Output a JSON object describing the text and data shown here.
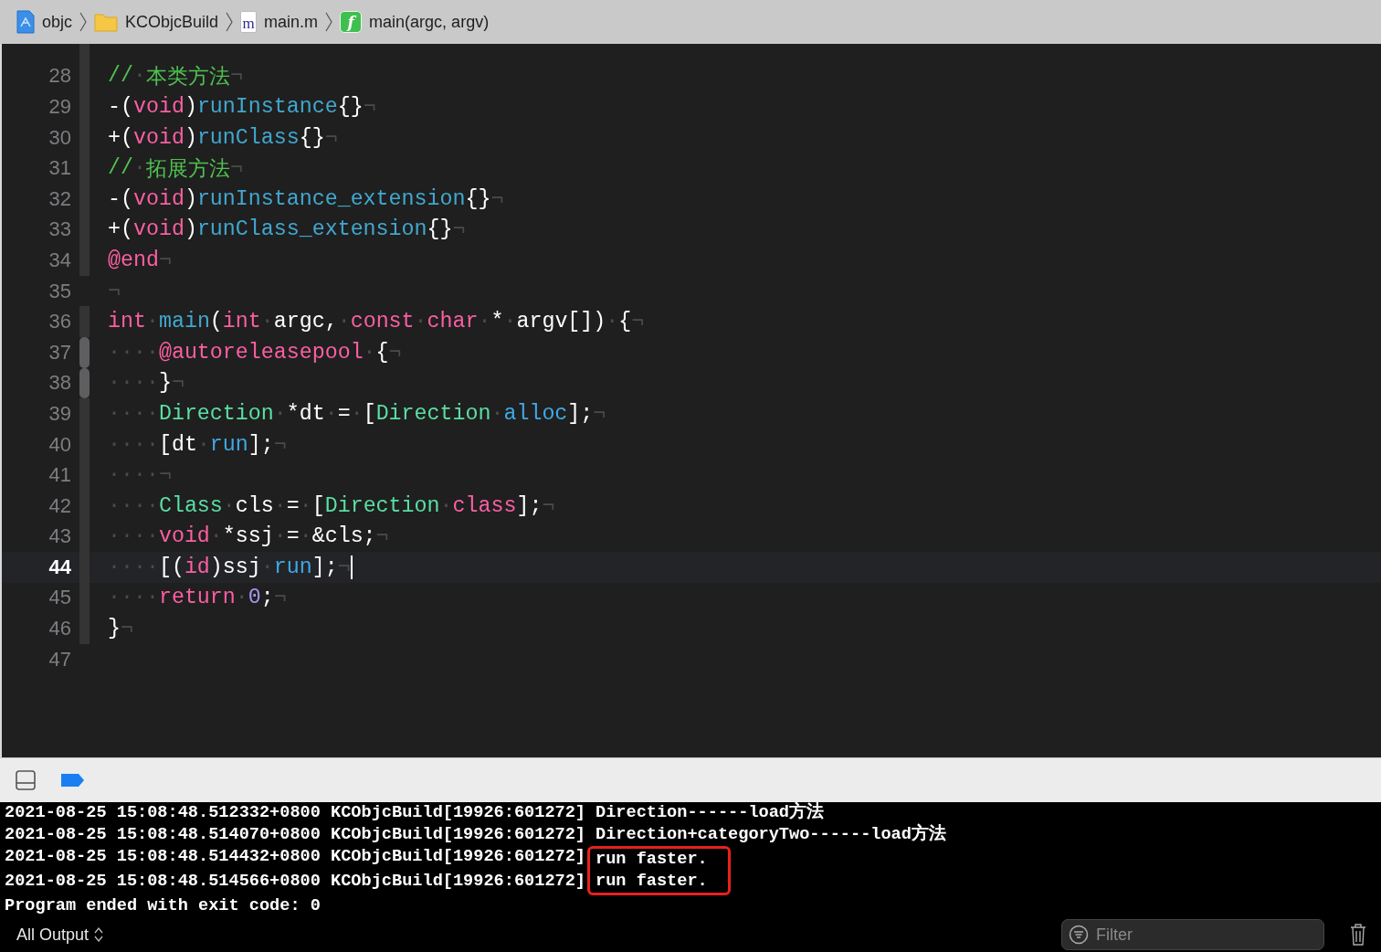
{
  "breadcrumb": [
    {
      "kind": "project",
      "label": "objc"
    },
    {
      "kind": "folder",
      "label": "KCObjcBuild"
    },
    {
      "kind": "file",
      "glyph": "m",
      "label": "main.m"
    },
    {
      "kind": "function",
      "glyph": "f",
      "label": "main(argc, argv)"
    }
  ],
  "editor": {
    "lines": [
      {
        "number": "28",
        "current": false,
        "in_scope": true,
        "inner_scope": false,
        "tokens": [
          {
            "kind": "cm",
            "t": "//"
          },
          {
            "kind": "ws",
            "t": "·"
          },
          {
            "kind": "cm",
            "t": "本类方法"
          },
          {
            "kind": "ws",
            "t": "¬"
          }
        ]
      },
      {
        "number": "29",
        "current": false,
        "in_scope": true,
        "inner_scope": false,
        "tokens": [
          {
            "kind": "p",
            "t": "-("
          },
          {
            "kind": "kw",
            "t": "void"
          },
          {
            "kind": "p",
            "t": ")"
          },
          {
            "kind": "decl",
            "t": "runInstance"
          },
          {
            "kind": "p",
            "t": "{}"
          },
          {
            "kind": "ws",
            "t": "¬"
          }
        ]
      },
      {
        "number": "30",
        "current": false,
        "in_scope": true,
        "inner_scope": false,
        "tokens": [
          {
            "kind": "p",
            "t": "+("
          },
          {
            "kind": "kw",
            "t": "void"
          },
          {
            "kind": "p",
            "t": ")"
          },
          {
            "kind": "decl",
            "t": "runClass"
          },
          {
            "kind": "p",
            "t": "{}"
          },
          {
            "kind": "ws",
            "t": "¬"
          }
        ]
      },
      {
        "number": "31",
        "current": false,
        "in_scope": true,
        "inner_scope": false,
        "tokens": [
          {
            "kind": "cm",
            "t": "//"
          },
          {
            "kind": "ws",
            "t": "·"
          },
          {
            "kind": "cm",
            "t": "拓展方法"
          },
          {
            "kind": "ws",
            "t": "¬"
          }
        ]
      },
      {
        "number": "32",
        "current": false,
        "in_scope": true,
        "inner_scope": false,
        "tokens": [
          {
            "kind": "p",
            "t": "-("
          },
          {
            "kind": "kw",
            "t": "void"
          },
          {
            "kind": "p",
            "t": ")"
          },
          {
            "kind": "decl",
            "t": "runInstance_extension"
          },
          {
            "kind": "p",
            "t": "{}"
          },
          {
            "kind": "ws",
            "t": "¬"
          }
        ]
      },
      {
        "number": "33",
        "current": false,
        "in_scope": true,
        "inner_scope": false,
        "tokens": [
          {
            "kind": "p",
            "t": "+("
          },
          {
            "kind": "kw",
            "t": "void"
          },
          {
            "kind": "p",
            "t": ")"
          },
          {
            "kind": "decl",
            "t": "runClass_extension"
          },
          {
            "kind": "p",
            "t": "{}"
          },
          {
            "kind": "ws",
            "t": "¬"
          }
        ]
      },
      {
        "number": "34",
        "current": false,
        "in_scope": true,
        "inner_scope": false,
        "tokens": [
          {
            "kind": "kw",
            "t": "@end"
          },
          {
            "kind": "ws",
            "t": "¬"
          }
        ]
      },
      {
        "number": "35",
        "current": false,
        "in_scope": false,
        "inner_scope": false,
        "tokens": [
          {
            "kind": "ws",
            "t": "¬"
          }
        ]
      },
      {
        "number": "36",
        "current": false,
        "in_scope": true,
        "inner_scope": false,
        "tokens": [
          {
            "kind": "kw",
            "t": "int"
          },
          {
            "kind": "ws",
            "t": "·"
          },
          {
            "kind": "decl",
            "t": "main"
          },
          {
            "kind": "p",
            "t": "("
          },
          {
            "kind": "kw",
            "t": "int"
          },
          {
            "kind": "ws",
            "t": "·"
          },
          {
            "kind": "p",
            "t": "argc,"
          },
          {
            "kind": "ws",
            "t": "·"
          },
          {
            "kind": "kw",
            "t": "const"
          },
          {
            "kind": "ws",
            "t": "·"
          },
          {
            "kind": "kw",
            "t": "char"
          },
          {
            "kind": "ws",
            "t": "·"
          },
          {
            "kind": "p",
            "t": "*"
          },
          {
            "kind": "ws",
            "t": "·"
          },
          {
            "kind": "p",
            "t": "argv[])"
          },
          {
            "kind": "ws",
            "t": "·"
          },
          {
            "kind": "p",
            "t": "{"
          },
          {
            "kind": "ws",
            "t": "¬"
          }
        ]
      },
      {
        "number": "37",
        "current": false,
        "in_scope": true,
        "inner_scope": true,
        "tokens": [
          {
            "kind": "ws",
            "t": "····"
          },
          {
            "kind": "kw",
            "t": "@autoreleasepool"
          },
          {
            "kind": "ws",
            "t": "·"
          },
          {
            "kind": "p",
            "t": "{"
          },
          {
            "kind": "ws",
            "t": "¬"
          }
        ]
      },
      {
        "number": "38",
        "current": false,
        "in_scope": true,
        "inner_scope": true,
        "tokens": [
          {
            "kind": "ws",
            "t": "····"
          },
          {
            "kind": "p",
            "t": "}"
          },
          {
            "kind": "ws",
            "t": "¬"
          }
        ]
      },
      {
        "number": "39",
        "current": false,
        "in_scope": true,
        "inner_scope": false,
        "tokens": [
          {
            "kind": "ws",
            "t": "····"
          },
          {
            "kind": "cls",
            "t": "Direction"
          },
          {
            "kind": "ws",
            "t": "·"
          },
          {
            "kind": "p",
            "t": "*dt"
          },
          {
            "kind": "ws",
            "t": "·"
          },
          {
            "kind": "p",
            "t": "="
          },
          {
            "kind": "ws",
            "t": "·"
          },
          {
            "kind": "p",
            "t": "["
          },
          {
            "kind": "cls",
            "t": "Direction"
          },
          {
            "kind": "ws",
            "t": "·"
          },
          {
            "kind": "meth",
            "t": "alloc"
          },
          {
            "kind": "p",
            "t": "];"
          },
          {
            "kind": "ws",
            "t": "¬"
          }
        ]
      },
      {
        "number": "40",
        "current": false,
        "in_scope": true,
        "inner_scope": false,
        "tokens": [
          {
            "kind": "ws",
            "t": "····"
          },
          {
            "kind": "p",
            "t": "[dt"
          },
          {
            "kind": "ws",
            "t": "·"
          },
          {
            "kind": "meth",
            "t": "run"
          },
          {
            "kind": "p",
            "t": "];"
          },
          {
            "kind": "ws",
            "t": "¬"
          }
        ]
      },
      {
        "number": "41",
        "current": false,
        "in_scope": true,
        "inner_scope": false,
        "tokens": [
          {
            "kind": "ws",
            "t": "····¬"
          }
        ]
      },
      {
        "number": "42",
        "current": false,
        "in_scope": true,
        "inner_scope": false,
        "tokens": [
          {
            "kind": "ws",
            "t": "····"
          },
          {
            "kind": "cls",
            "t": "Class"
          },
          {
            "kind": "ws",
            "t": "·"
          },
          {
            "kind": "p",
            "t": "cls"
          },
          {
            "kind": "ws",
            "t": "·"
          },
          {
            "kind": "p",
            "t": "="
          },
          {
            "kind": "ws",
            "t": "·"
          },
          {
            "kind": "p",
            "t": "["
          },
          {
            "kind": "cls",
            "t": "Direction"
          },
          {
            "kind": "ws",
            "t": "·"
          },
          {
            "kind": "kw",
            "t": "class"
          },
          {
            "kind": "p",
            "t": "];"
          },
          {
            "kind": "ws",
            "t": "¬"
          }
        ]
      },
      {
        "number": "43",
        "current": false,
        "in_scope": true,
        "inner_scope": false,
        "tokens": [
          {
            "kind": "ws",
            "t": "····"
          },
          {
            "kind": "kw",
            "t": "void"
          },
          {
            "kind": "ws",
            "t": "·"
          },
          {
            "kind": "p",
            "t": "*ssj"
          },
          {
            "kind": "ws",
            "t": "·"
          },
          {
            "kind": "p",
            "t": "="
          },
          {
            "kind": "ws",
            "t": "·"
          },
          {
            "kind": "p",
            "t": "&cls;"
          },
          {
            "kind": "ws",
            "t": "¬"
          }
        ]
      },
      {
        "number": "44",
        "current": true,
        "in_scope": true,
        "inner_scope": false,
        "tokens": [
          {
            "kind": "ws",
            "t": "····"
          },
          {
            "kind": "p",
            "t": "[("
          },
          {
            "kind": "kw",
            "t": "id"
          },
          {
            "kind": "p",
            "t": ")ssj"
          },
          {
            "kind": "ws",
            "t": "·"
          },
          {
            "kind": "meth",
            "t": "run"
          },
          {
            "kind": "p",
            "t": "];"
          },
          {
            "kind": "ws",
            "t": "¬"
          }
        ]
      },
      {
        "number": "45",
        "current": false,
        "in_scope": true,
        "inner_scope": false,
        "tokens": [
          {
            "kind": "ws",
            "t": "····"
          },
          {
            "kind": "kw",
            "t": "return"
          },
          {
            "kind": "ws",
            "t": "·"
          },
          {
            "kind": "num",
            "t": "0"
          },
          {
            "kind": "p",
            "t": ";"
          },
          {
            "kind": "ws",
            "t": "¬"
          }
        ]
      },
      {
        "number": "46",
        "current": false,
        "in_scope": true,
        "inner_scope": false,
        "tokens": [
          {
            "kind": "p",
            "t": "}"
          },
          {
            "kind": "ws",
            "t": "¬"
          }
        ]
      },
      {
        "number": "47",
        "current": false,
        "in_scope": false,
        "inner_scope": false
      }
    ]
  },
  "console": {
    "lines": [
      {
        "prefix": "2021-08-25 15:08:48.512332+0800 KCObjcBuild[19926:601272]",
        "message": "Direction------load方法",
        "boxed": false
      },
      {
        "prefix": "2021-08-25 15:08:48.514070+0800 KCObjcBuild[19926:601272]",
        "message": "Direction+categoryTwo------load方法",
        "boxed": false
      },
      {
        "prefix": "2021-08-25 15:08:48.514432+0800 KCObjcBuild[19926:601272]",
        "message": "run faster.",
        "boxed": true
      },
      {
        "prefix": "2021-08-25 15:08:48.514566+0800 KCObjcBuild[19926:601272]",
        "message": "run faster.",
        "boxed": true
      },
      {
        "message": "Program ended with exit code: 0",
        "boxed": false
      }
    ],
    "output_selector": "All Output",
    "filter": {
      "placeholder": "Filter"
    }
  }
}
